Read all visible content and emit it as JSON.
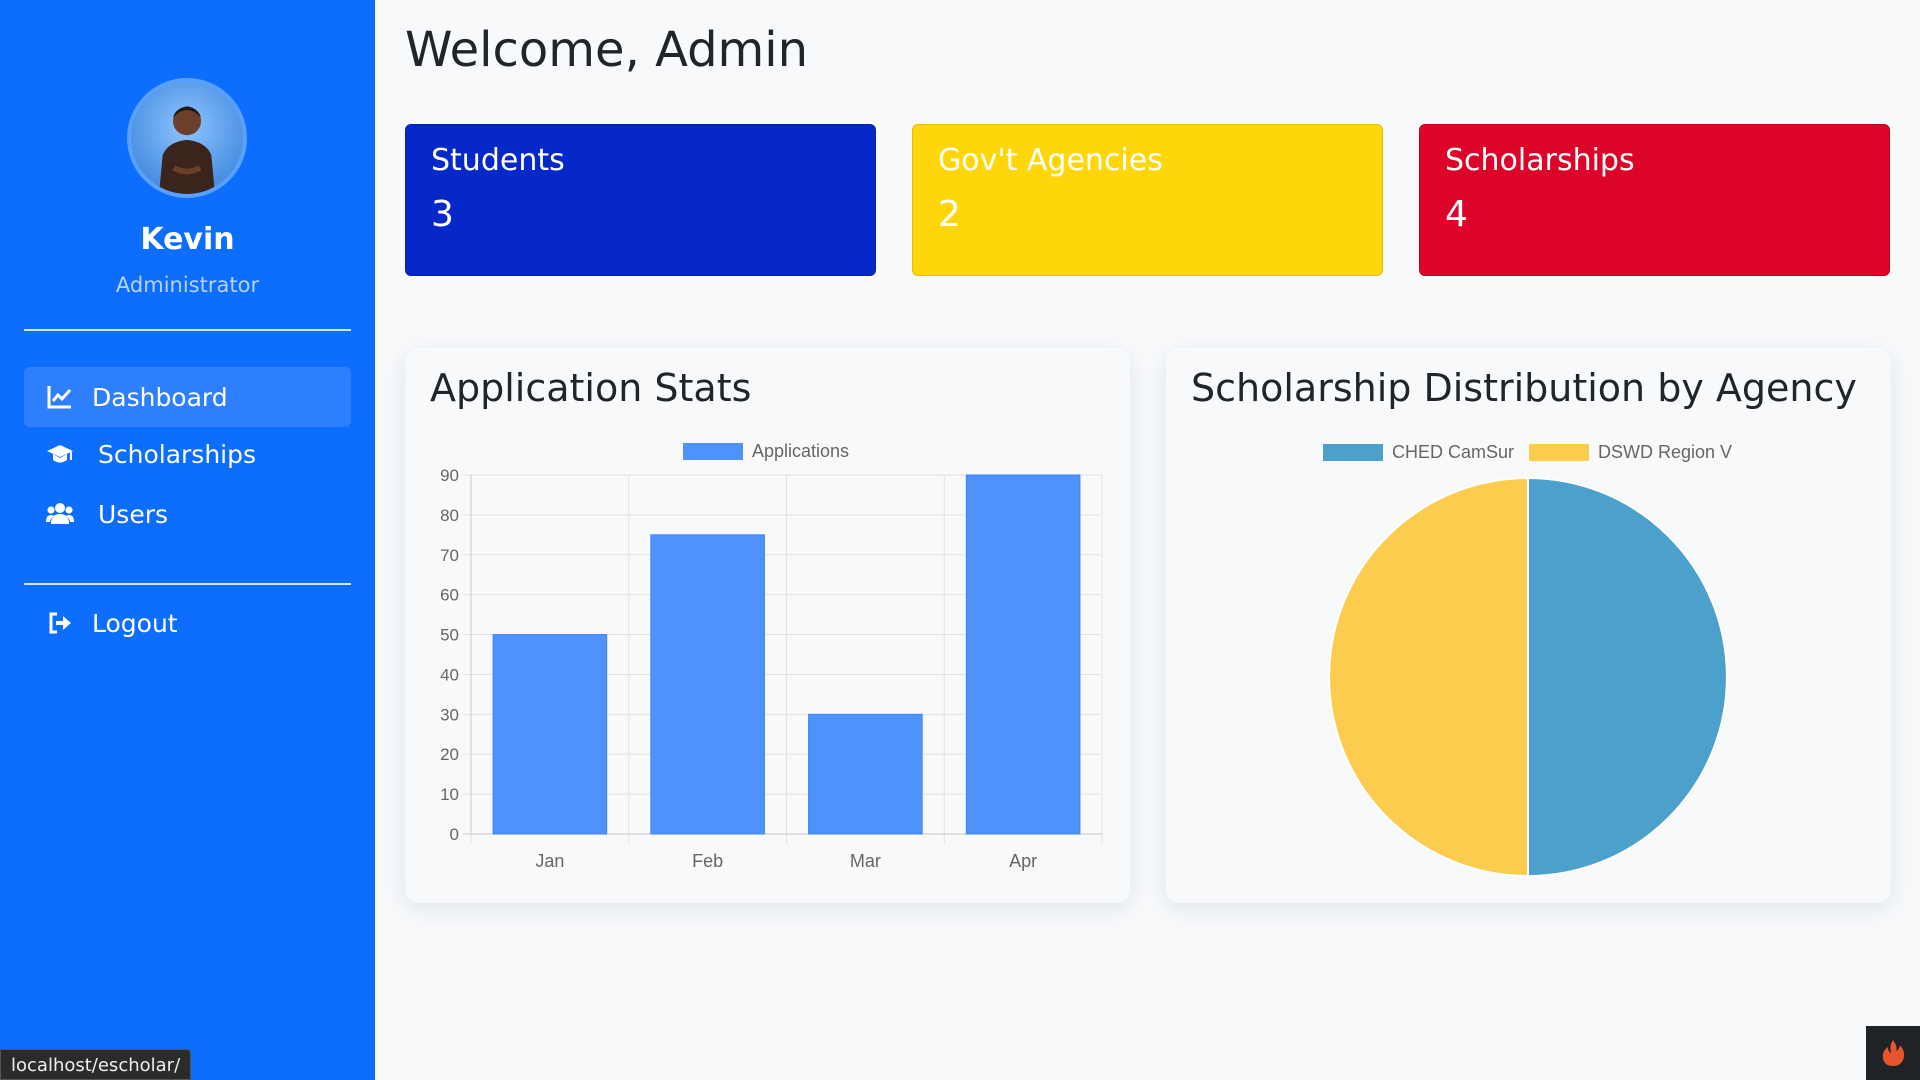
{
  "sidebar": {
    "user_name": "Kevin",
    "user_role": "Administrator",
    "nav": [
      {
        "label": "Dashboard",
        "icon": "chart-line-icon",
        "active": true
      },
      {
        "label": "Scholarships",
        "icon": "graduation-cap-icon",
        "active": false
      },
      {
        "label": "Users",
        "icon": "users-icon",
        "active": false
      }
    ],
    "logout_label": "Logout"
  },
  "main": {
    "welcome": "Welcome, Admin",
    "stats": [
      {
        "label": "Students",
        "value": "3",
        "color": "#0628c8"
      },
      {
        "label": "Gov't Agencies",
        "value": "2",
        "color": "#ffd60a"
      },
      {
        "label": "Scholarships",
        "value": "4",
        "color": "#dc0428"
      }
    ]
  },
  "panels": {
    "left_title": "Application Stats",
    "right_title": "Scholarship Distribution by Agency"
  },
  "chart_data": [
    {
      "type": "bar",
      "title": "Application Stats",
      "categories": [
        "Jan",
        "Feb",
        "Mar",
        "Apr"
      ],
      "series": [
        {
          "name": "Applications",
          "values": [
            50,
            75,
            30,
            90
          ],
          "color": "#4f92fc"
        }
      ],
      "ylim": [
        0,
        90
      ],
      "yticks": [
        0,
        10,
        20,
        30,
        40,
        50,
        60,
        70,
        80,
        90
      ],
      "grid": true,
      "legend": "top"
    },
    {
      "type": "pie",
      "title": "Scholarship Distribution by Agency",
      "labels": [
        "CHED CamSur",
        "DSWD Region V"
      ],
      "values": [
        1,
        1
      ],
      "colors": [
        "#4ba1cb",
        "#fccc4f"
      ],
      "legend": "top"
    }
  ],
  "statusbar": {
    "url": "localhost/escholar/"
  },
  "colors": {
    "sidebar": "#0d6efd",
    "active_nav": "#2d7ffd",
    "background": "#f7f9fb"
  }
}
